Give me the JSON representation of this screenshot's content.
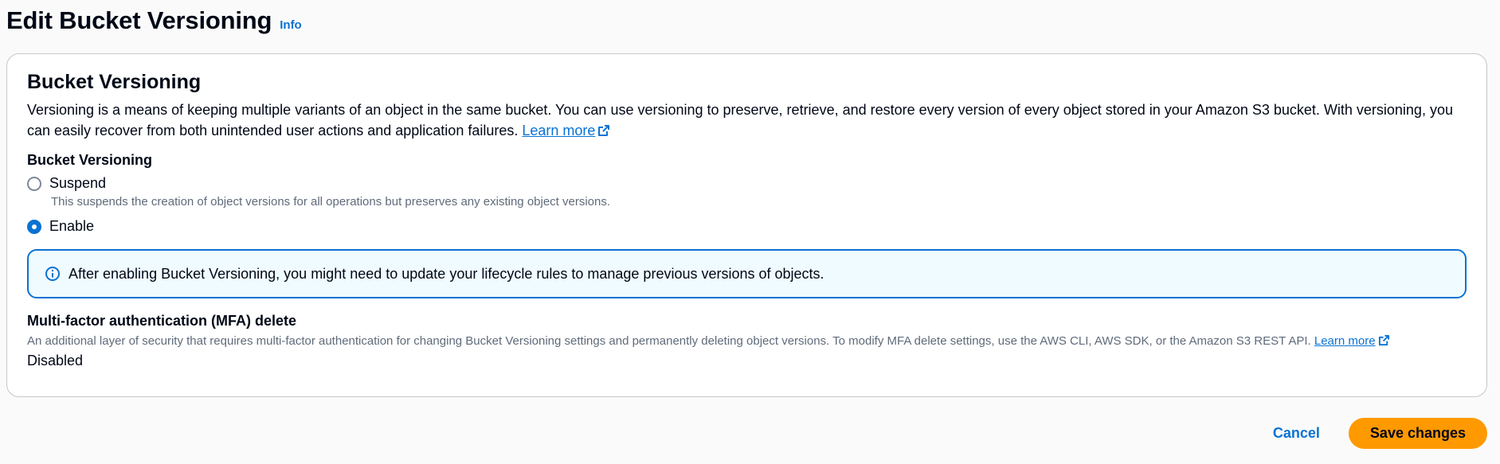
{
  "header": {
    "title": "Edit Bucket Versioning",
    "info_link": "Info"
  },
  "versioning": {
    "title": "Bucket Versioning",
    "description": "Versioning is a means of keeping multiple variants of an object in the same bucket. You can use versioning to preserve, retrieve, and restore every version of every object stored in your Amazon S3 bucket. With versioning, you can easily recover from both unintended user actions and application failures.",
    "learn_more": "Learn more",
    "field_label": "Bucket Versioning",
    "options": [
      {
        "label": "Suspend",
        "description": "This suspends the creation of object versions for all operations but preserves any existing object versions.",
        "selected": false
      },
      {
        "label": "Enable",
        "selected": true
      }
    ],
    "alert": {
      "icon": "info-circle-icon",
      "text": "After enabling Bucket Versioning, you might need to update your lifecycle rules to manage previous versions of objects."
    }
  },
  "mfa": {
    "label": "Multi-factor authentication (MFA) delete",
    "description": "An additional layer of security that requires multi-factor authentication for changing Bucket Versioning settings and permanently deleting object versions. To modify MFA delete settings, use the AWS CLI, AWS SDK, or the Amazon S3 REST API.",
    "learn_more": "Learn more",
    "value": "Disabled"
  },
  "actions": {
    "cancel_label": "Cancel",
    "save_label": "Save changes"
  },
  "colors": {
    "link": "#0972d3",
    "primary_button": "#ff9900",
    "alert_border": "#0972d3",
    "alert_background": "#f0fbff"
  }
}
